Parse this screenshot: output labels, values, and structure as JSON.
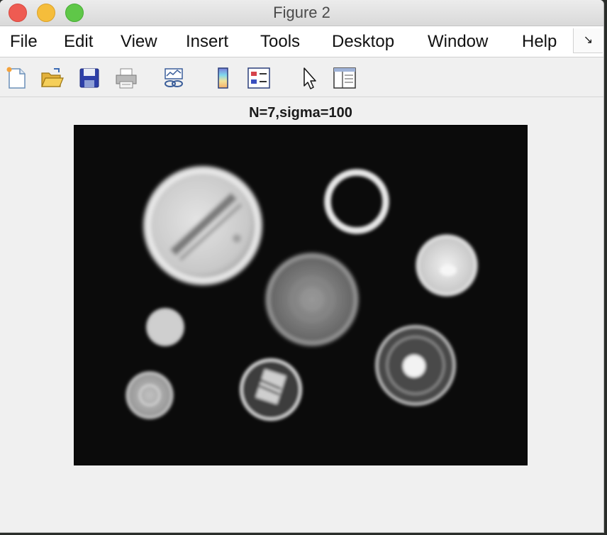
{
  "window": {
    "title": "Figure 2"
  },
  "menu": [
    "File",
    "Edit",
    "View",
    "Insert",
    "Tools",
    "Desktop",
    "Window",
    "Help"
  ],
  "menu_overflow": "↘",
  "toolbar": [
    "new-figure-icon",
    "open-file-icon",
    "save-icon",
    "print-icon",
    "link-plot-icon",
    "colorbar-icon",
    "legend-icon",
    "pointer-icon",
    "property-editor-icon"
  ],
  "figure": {
    "title": "N=7,sigma=100",
    "image": "blurred grayscale photo of coins"
  },
  "colors": {
    "window_bg": "#f0f0f0",
    "image_bg": "#0b0b0b",
    "close": "#ee5b52",
    "minimize": "#f5bd3b",
    "maximize": "#5fc748"
  }
}
